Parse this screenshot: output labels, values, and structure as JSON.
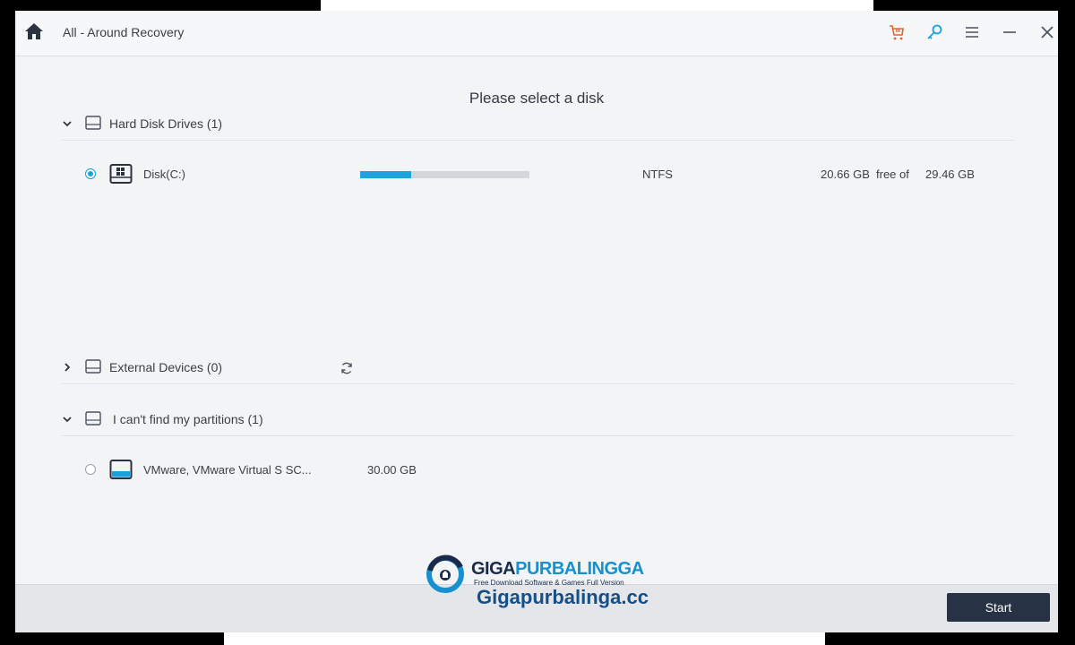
{
  "window": {
    "title": "All - Around Recovery"
  },
  "main": {
    "heading": "Please select a disk",
    "sections": [
      {
        "label": "Hard Disk Drives (1)",
        "expanded": true
      },
      {
        "label": "External Devices (0)",
        "expanded": false
      },
      {
        "label": "I can't find my partitions (1)",
        "expanded": true
      }
    ],
    "disks": [
      {
        "name": "Disk(C:)",
        "used_fraction": 0.3,
        "filesystem": "NTFS",
        "free": "20.66 GB",
        "free_of_label": "free of",
        "total": "29.46 GB",
        "selected": true
      }
    ],
    "lost_devices": [
      {
        "name": "VMware, VMware Virtual S SC...",
        "size": "30.00 GB",
        "selected": false
      }
    ]
  },
  "footer": {
    "start_label": "Start"
  },
  "watermark": {
    "brand_part1": "GIGA",
    "brand_part2": "PURBALINGGA",
    "tagline": "Free Download Software & Games Full Version",
    "site": "Gigapurbalinga.cc"
  },
  "icons": {
    "home": "home-icon",
    "cart": "cart-icon",
    "key": "key-icon",
    "menu": "menu-icon",
    "minimize": "minimize-icon",
    "close": "close-icon",
    "refresh": "refresh-icon",
    "drive": "drive-icon",
    "chevron": "chevron-icon"
  },
  "colors": {
    "accent": "#1ea4dd",
    "cart": "#e8622a",
    "start_button": "#273244"
  }
}
